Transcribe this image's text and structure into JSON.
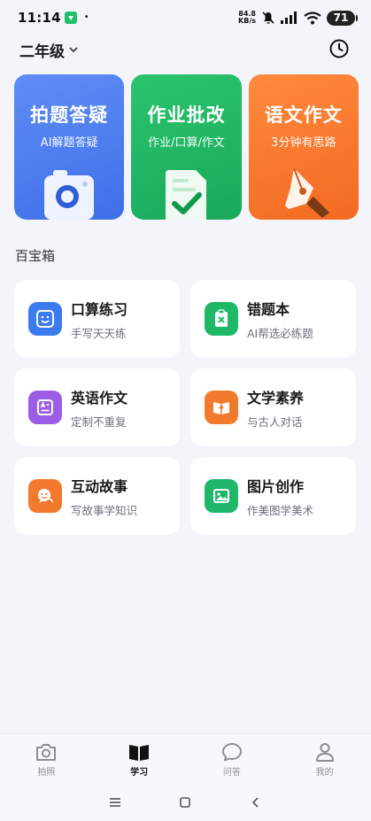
{
  "status_bar": {
    "time": "11:14",
    "net_speed_value": "84.8",
    "net_speed_unit": "KB/s",
    "battery": "71"
  },
  "header": {
    "grade": "二年级"
  },
  "big_cards": [
    {
      "title": "拍题答疑",
      "subtitle": "AI解题答疑",
      "color": "#4f7ef0",
      "icon": "camera-icon"
    },
    {
      "title": "作业批改",
      "subtitle": "作业/口算/作文",
      "color": "#20b866",
      "icon": "checked-document-icon"
    },
    {
      "title": "语文作文",
      "subtitle": "3分钟有思路",
      "color": "#f97a2e",
      "icon": "fountain-pen-icon"
    }
  ],
  "section": {
    "title": "百宝箱"
  },
  "tools": [
    {
      "title": "口算练习",
      "subtitle": "手写天天练",
      "color": "#3a7bef",
      "icon": "smile-calc-icon"
    },
    {
      "title": "错题本",
      "subtitle": "AI帮选必练题",
      "color": "#1fb869",
      "icon": "clipboard-x-icon"
    },
    {
      "title": "英语作文",
      "subtitle": "定制不重复",
      "color": "#9b5de5",
      "icon": "letter-a-doc-icon"
    },
    {
      "title": "文学素养",
      "subtitle": "与古人对话",
      "color": "#f27a2c",
      "icon": "open-book-icon"
    },
    {
      "title": "互动故事",
      "subtitle": "写故事学知识",
      "color": "#f27a2c",
      "icon": "chat-bubbles-icon"
    },
    {
      "title": "图片创作",
      "subtitle": "作美图学美术",
      "color": "#1fb869",
      "icon": "image-icon"
    }
  ],
  "bottom_nav": [
    {
      "label": "拍照",
      "icon": "camera-outline-icon",
      "active": false
    },
    {
      "label": "学习",
      "icon": "book-icon",
      "active": true
    },
    {
      "label": "问答",
      "icon": "chat-outline-icon",
      "active": false
    },
    {
      "label": "我的",
      "icon": "person-icon",
      "active": false
    }
  ]
}
